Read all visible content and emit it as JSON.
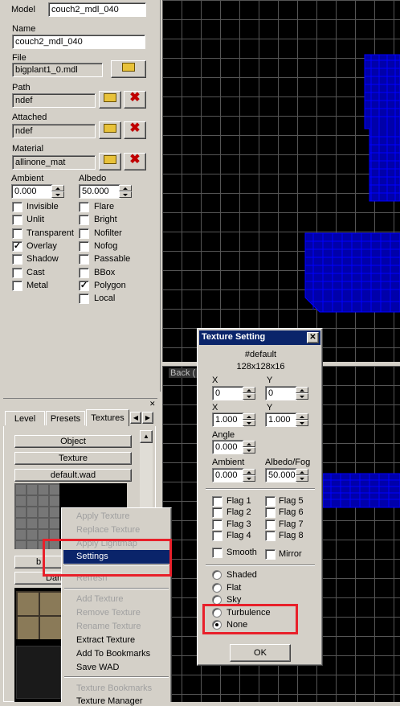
{
  "props": {
    "model_label": "Model",
    "model_value": "couch2_mdl_040",
    "name_label": "Name",
    "name_value": "couch2_mdl_040",
    "file_label": "File",
    "file_value": "bigplant1_0.mdl",
    "path_label": "Path",
    "path_value": "ndef",
    "attached_label": "Attached",
    "attached_value": "ndef",
    "material_label": "Material",
    "material_value": "allinone_mat",
    "ambient_label": "Ambient",
    "ambient_value": "0.000",
    "albedo_label": "Albedo",
    "albedo_value": "50.000",
    "flags_left": [
      {
        "label": "Invisible",
        "checked": false
      },
      {
        "label": "Unlit",
        "checked": false
      },
      {
        "label": "Transparent",
        "checked": false
      },
      {
        "label": "Overlay",
        "checked": true
      },
      {
        "label": "Shadow",
        "checked": false
      },
      {
        "label": "Cast",
        "checked": false
      },
      {
        "label": "Metal",
        "checked": false
      }
    ],
    "flags_right": [
      {
        "label": "Flare",
        "checked": false
      },
      {
        "label": "Bright",
        "checked": false
      },
      {
        "label": "Nofilter",
        "checked": false
      },
      {
        "label": "Nofog",
        "checked": false
      },
      {
        "label": "Passable",
        "checked": false
      },
      {
        "label": "BBox",
        "checked": false
      },
      {
        "label": "Polygon",
        "checked": true
      },
      {
        "label": "Local",
        "checked": false
      }
    ]
  },
  "tabs": {
    "items": [
      "Level",
      "Presets",
      "Textures"
    ],
    "active": "Textures"
  },
  "textures_panel": {
    "object_btn": "Object",
    "texture_btn": "Texture",
    "wad_btn": "default.wad",
    "partial_btn1": "b",
    "partial_btn2": "Darl"
  },
  "context_menu": {
    "items": [
      {
        "label": "Apply Texture",
        "disabled": true
      },
      {
        "label": "Replace Texture",
        "disabled": true
      },
      {
        "label": "Apply Lightmap",
        "disabled": true
      },
      {
        "label": "Settings",
        "disabled": false,
        "highlighted": true
      },
      {
        "label": "Refresh",
        "disabled": true
      },
      {
        "label": "Add Texture",
        "disabled": true
      },
      {
        "label": "Remove Texture",
        "disabled": true
      },
      {
        "label": "Rename Texture",
        "disabled": true
      },
      {
        "label": "Extract Texture",
        "disabled": false
      },
      {
        "label": "Add To Bookmarks",
        "disabled": false
      },
      {
        "label": "Save WAD",
        "disabled": false
      },
      {
        "label": "Texture Bookmarks",
        "disabled": true
      },
      {
        "label": "Texture Manager",
        "disabled": false
      }
    ]
  },
  "viewport": {
    "back_label": "Back (",
    "accent": "#0000ff"
  },
  "dialog": {
    "title": "Texture Setting",
    "tex_name": "#default",
    "tex_size": "128x128x16",
    "x1_label": "X",
    "y1_label": "Y",
    "x1_value": "0",
    "y1_value": "0",
    "x2_label": "X",
    "y2_label": "Y",
    "x2_value": "1.000",
    "y2_value": "1.000",
    "angle_label": "Angle",
    "angle_value": "0.000",
    "ambient_label": "Ambient",
    "ambient_value": "0.000",
    "albedo_label": "Albedo/Fog",
    "albedo_value": "50.000",
    "flags_left": [
      "Flag 1",
      "Flag 2",
      "Flag 3",
      "Flag 4"
    ],
    "flags_right": [
      "Flag 5",
      "Flag 6",
      "Flag 7",
      "Flag 8"
    ],
    "smooth_label": "Smooth",
    "mirror_label": "Mirror",
    "radios": [
      {
        "label": "Shaded",
        "selected": false
      },
      {
        "label": "Flat",
        "selected": false
      },
      {
        "label": "Sky",
        "selected": false
      },
      {
        "label": "Turbulence",
        "selected": false
      },
      {
        "label": "None",
        "selected": true
      }
    ],
    "ok_label": "OK"
  },
  "highlight_color": "#e8202a"
}
